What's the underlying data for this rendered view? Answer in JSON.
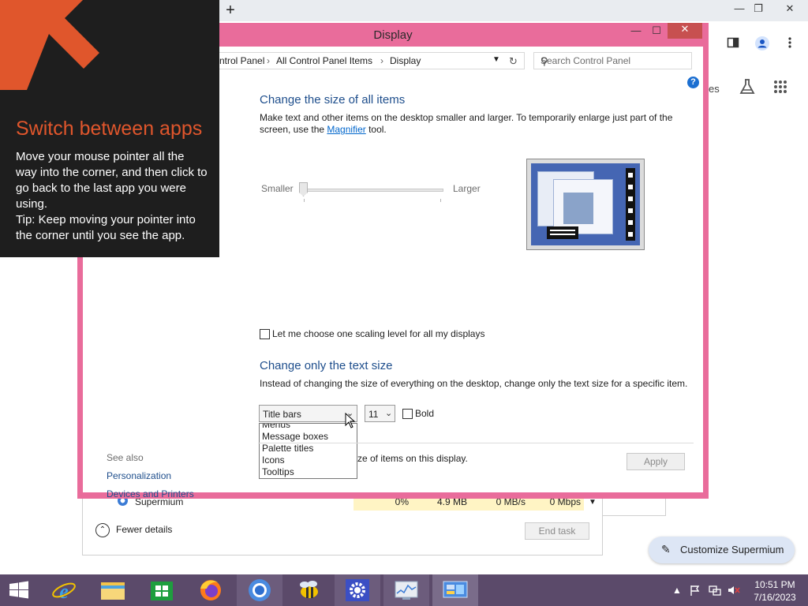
{
  "browser": {
    "new_tab": "+",
    "window_controls": [
      "—",
      "❐",
      "✕"
    ],
    "toolbar_partial_text": "es",
    "customize_button": "Customize Supermium"
  },
  "task_manager": {
    "row": {
      "name": "Supermium",
      "cpu": "0%",
      "memory": "4.9 MB",
      "disk": "0 MB/s",
      "network": "0 Mbps"
    },
    "fewer_details": "Fewer details",
    "end_task": "End task"
  },
  "window": {
    "title": "Display",
    "controls": {
      "minimize": "—",
      "maximize": "☐",
      "close": "✕"
    },
    "address": {
      "crumbs": [
        "ntrol Panel",
        "All Control Panel Items",
        "Display"
      ],
      "sep": "›"
    },
    "search_placeholder": "Search Control Panel",
    "help": "?"
  },
  "size_section": {
    "heading": "Change the size of all items",
    "desc_1": "Make text and other items on the desktop smaller and larger. To temporarily enlarge just part of the",
    "desc_2_pre": "screen, use the ",
    "desc_2_link": "Magnifier",
    "desc_2_post": " tool.",
    "slider": {
      "min_label": "Smaller",
      "max_label": "Larger",
      "level": 0
    }
  },
  "scaling_checkbox": {
    "label": "Let me choose one scaling level for all my displays",
    "checked": false
  },
  "text_section": {
    "heading": "Change only the text size",
    "desc": "Instead of changing the size of everything on the desktop, change only the text size for a specific item.",
    "item_select": "Title bars",
    "size_select": "11",
    "bold_label": "Bold",
    "dropdown_items": [
      "Menus",
      "Message boxes",
      "Palette titles",
      "Icons",
      "Tooltips"
    ],
    "partial_text": "ze of items on this display."
  },
  "apply": "Apply",
  "see_also": {
    "title": "See also",
    "links": [
      "Personalization",
      "Devices and Printers"
    ]
  },
  "tip": {
    "title": "Switch between apps",
    "body": "Move your mouse pointer all the way into the corner, and then click to go back to the last app you were using.",
    "tip_line": "Tip: Keep moving your pointer into the corner until you see the app.",
    "accent_color": "#e0562c"
  },
  "taskbar": {
    "apps": [
      "start-icon",
      "internet-explorer-icon",
      "file-explorer-icon",
      "store-icon",
      "firefox-icon",
      "chromium-icon",
      "bee-icon",
      "settings-icon",
      "task-manager-icon",
      "control-panel-icon"
    ],
    "clock_time": "10:51 PM",
    "clock_date": "7/16/2023"
  }
}
